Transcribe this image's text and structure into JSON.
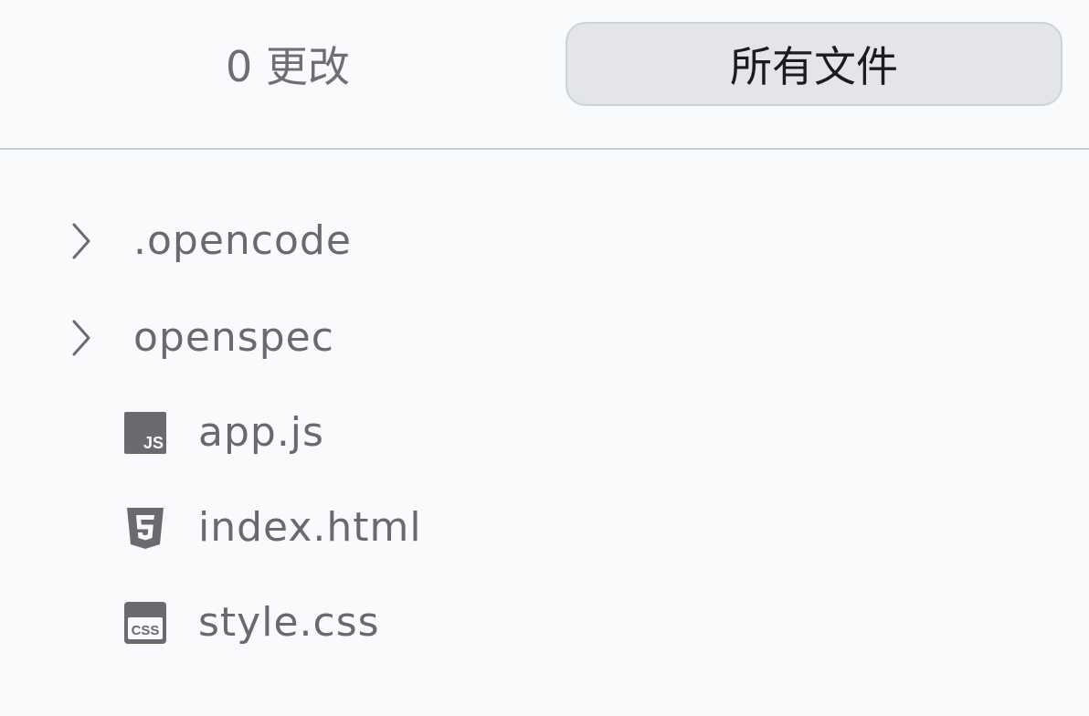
{
  "tabs": {
    "changes_label": "0 更改",
    "all_files_label": "所有文件",
    "active": "all_files"
  },
  "tree": {
    "folders": [
      {
        "name": ".opencode",
        "icon": "chevron-right-icon",
        "expanded": false
      },
      {
        "name": "openspec",
        "icon": "chevron-right-icon",
        "expanded": false
      }
    ],
    "files": [
      {
        "name": "app.js",
        "icon": "js-file-icon",
        "icon_text": "JS"
      },
      {
        "name": "index.html",
        "icon": "html5-file-icon"
      },
      {
        "name": "style.css",
        "icon": "css-file-icon",
        "icon_text": "CSS"
      }
    ]
  },
  "colors": {
    "background": "#f9fafc",
    "active_tab_bg": "#e3e5e8",
    "text": "#6a6a6e",
    "icon": "#6b6b6f"
  }
}
